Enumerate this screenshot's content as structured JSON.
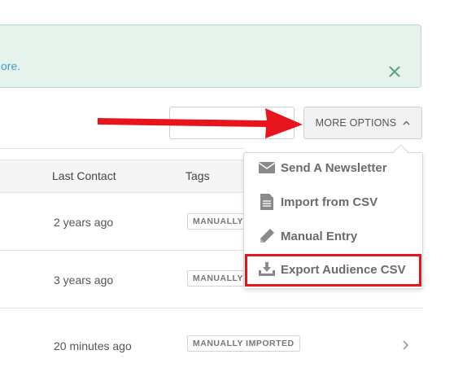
{
  "alert": {
    "text": "ore.",
    "close_icon": "close-icon"
  },
  "toolbar": {
    "search_placeholder": "",
    "more_options_label": "MORE OPTIONS",
    "more_options_icon": "chevron-up-icon"
  },
  "table": {
    "headers": [
      "Last Contact",
      "Tags"
    ],
    "rows": [
      {
        "last_contact": "2 years ago",
        "tag": "MANUALLY"
      },
      {
        "last_contact": "3 years ago",
        "tag": "MANUALLY"
      },
      {
        "last_contact": "20 minutes ago",
        "tag": "MANUALLY IMPORTED"
      }
    ]
  },
  "dropdown": {
    "items": [
      {
        "label": "Send A Newsletter",
        "icon": "envelope-icon"
      },
      {
        "label": "Import from CSV",
        "icon": "document-icon"
      },
      {
        "label": "Manual Entry",
        "icon": "pencil-icon"
      },
      {
        "label": "Export Audience CSV",
        "icon": "download-tray-icon"
      }
    ]
  },
  "colors": {
    "alert_bg": "#e6f3ec",
    "link": "#3aa0cf",
    "annotation_red": "#e8141c",
    "close_green": "#5aa37a"
  }
}
